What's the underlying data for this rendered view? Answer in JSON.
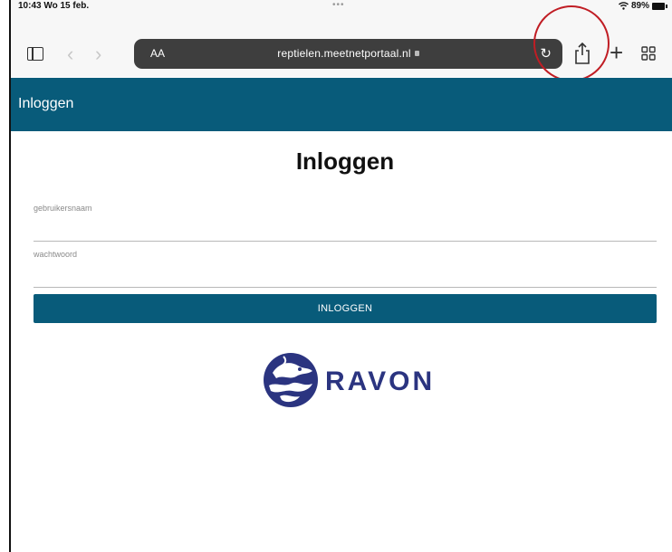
{
  "status": {
    "time": "10:43  Wo 15 feb.",
    "dots": "•••",
    "battery": "89%"
  },
  "browser": {
    "text_size_label": "AA",
    "url": "reptielen.meetnetportaal.nl"
  },
  "app_header": {
    "title": "Inloggen"
  },
  "login": {
    "heading": "Inloggen",
    "username_label": "gebruikersnaam",
    "password_label": "wachtwoord",
    "submit_label": "INLOGGEN"
  },
  "logo": {
    "text": "RAVON",
    "color": "#2b3480"
  },
  "colors": {
    "brand": "#085b7a",
    "highlight": "#c01d24"
  },
  "icons": [
    "sidebar-icon",
    "back-icon",
    "forward-icon",
    "lock-icon",
    "reload-icon",
    "share-icon",
    "plus-icon",
    "tabs-icon"
  ]
}
